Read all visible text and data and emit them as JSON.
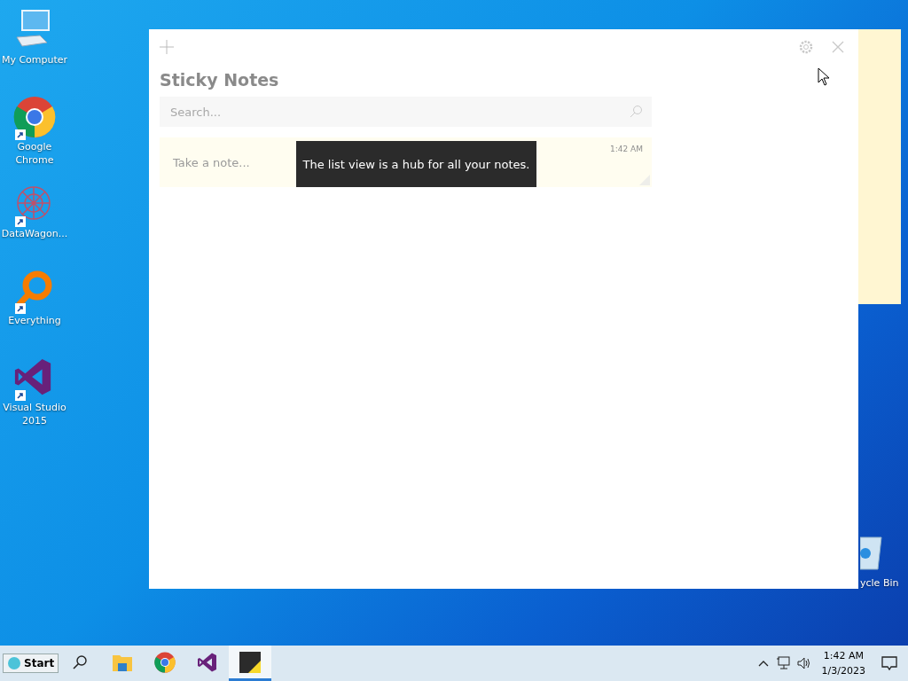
{
  "desktop_icons": [
    {
      "label": "My Computer",
      "kind": "computer",
      "shortcut": false
    },
    {
      "label": "Google Chrome",
      "kind": "chrome",
      "shortcut": true
    },
    {
      "label": "DataWagon...",
      "kind": "datawagon",
      "shortcut": true
    },
    {
      "label": "Everything",
      "kind": "everything",
      "shortcut": true
    },
    {
      "label": "Visual Studio 2015",
      "kind": "vs",
      "shortcut": true
    }
  ],
  "recycle_bin": {
    "label": "ycle Bin"
  },
  "window": {
    "title": "Sticky Notes",
    "search": {
      "placeholder": "Search..."
    },
    "notes": [
      {
        "placeholder": "Take a note...",
        "time": "1:42 AM"
      }
    ],
    "tooltip": "The list view is a hub for all your notes."
  },
  "taskbar": {
    "start": "Start",
    "apps": [
      {
        "kind": "explorer",
        "selected": false
      },
      {
        "kind": "chrome",
        "selected": false
      },
      {
        "kind": "vs",
        "selected": false
      },
      {
        "kind": "sticky",
        "selected": true
      }
    ],
    "time": "1:42 AM",
    "date": "1/3/2023"
  }
}
